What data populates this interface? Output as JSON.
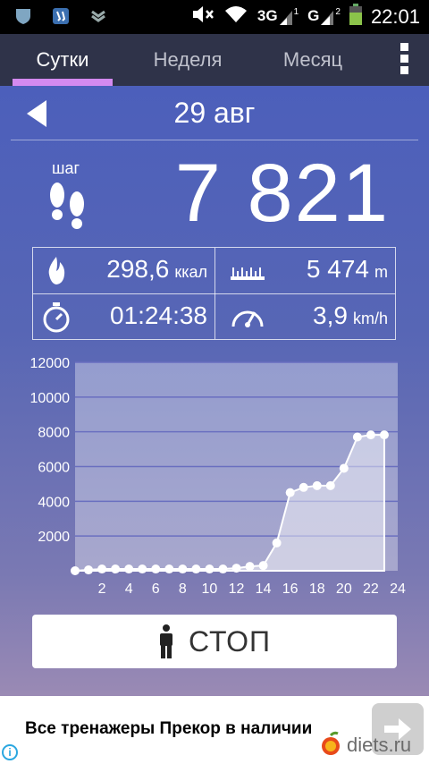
{
  "status_bar": {
    "network_3g": "3G",
    "network_sup_1": "1",
    "network_g": "G",
    "network_sup_2": "2",
    "time": "22:01"
  },
  "tabs": [
    {
      "label": "Сутки",
      "active": true
    },
    {
      "label": "Неделя",
      "active": false
    },
    {
      "label": "Месяц",
      "active": false
    }
  ],
  "date": "29 авг",
  "steps": {
    "label": "шаг",
    "value": "7 821"
  },
  "stats": {
    "calories": {
      "value": "298,6",
      "unit": "ккал"
    },
    "distance": {
      "value": "5 474",
      "unit": "m"
    },
    "duration": {
      "value": "01:24:38"
    },
    "speed": {
      "value": "3,9",
      "unit": "km/h"
    }
  },
  "colors": {
    "accent": "#d48af0",
    "tabbar": "#2f3349"
  },
  "chart_data": {
    "type": "area",
    "x": [
      0,
      1,
      2,
      3,
      4,
      5,
      6,
      7,
      8,
      9,
      10,
      11,
      12,
      13,
      14,
      15,
      16,
      17,
      18,
      19,
      20,
      21,
      22,
      23
    ],
    "values": [
      0,
      50,
      100,
      100,
      100,
      100,
      100,
      100,
      100,
      100,
      100,
      100,
      150,
      250,
      300,
      1600,
      4500,
      4800,
      4900,
      4900,
      5900,
      7700,
      7821,
      7821
    ],
    "y_ticks": [
      2000,
      4000,
      6000,
      8000,
      10000,
      12000
    ],
    "x_ticks": [
      2,
      4,
      6,
      8,
      10,
      12,
      14,
      16,
      18,
      20,
      22,
      24
    ],
    "ylim": [
      0,
      12000
    ],
    "xlim": [
      0,
      24
    ],
    "grid": true
  },
  "stop_button": {
    "label": "СТОП"
  },
  "ad": {
    "text": "Все тренажеры Прекор в наличии",
    "logo_text": "diets.ru"
  }
}
